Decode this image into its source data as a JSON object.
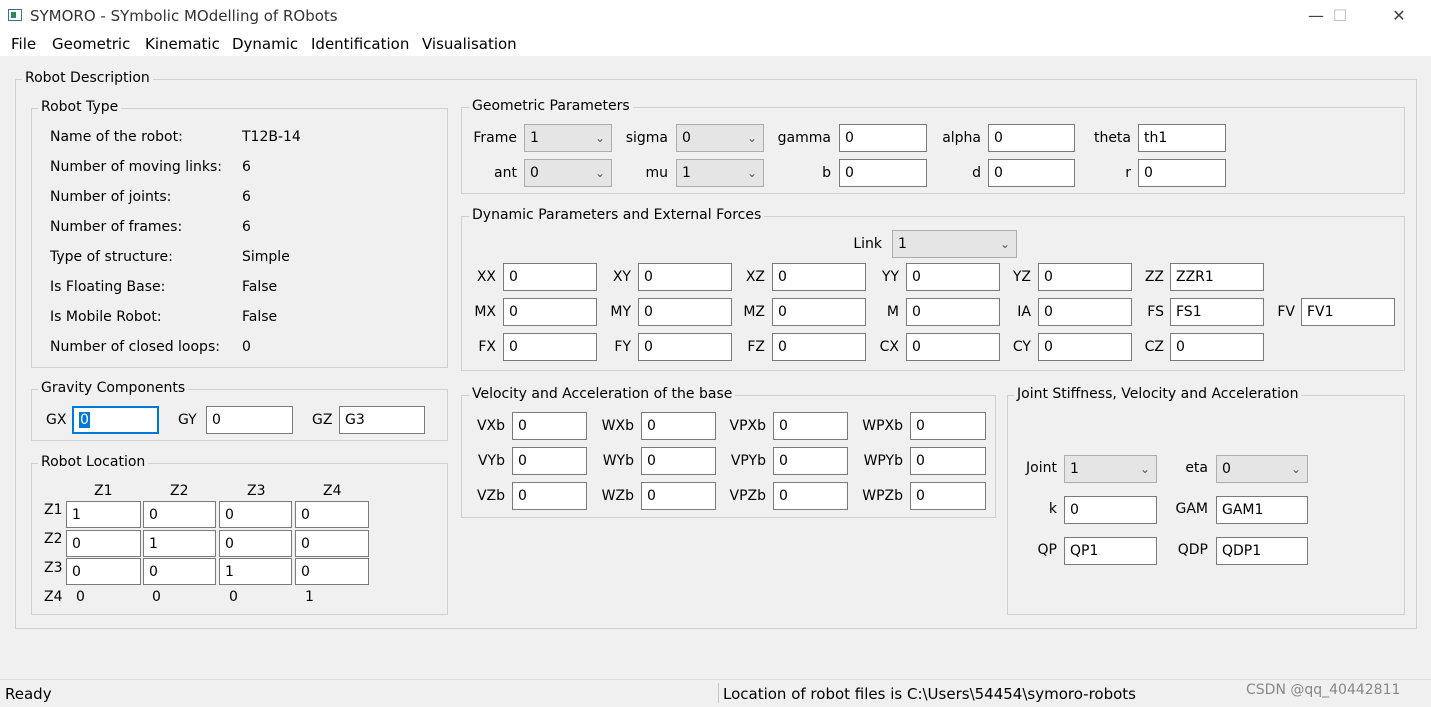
{
  "window": {
    "title": "SYMORO - SYmbolic MOdelling of RObots",
    "minimize": "—",
    "maximize": "☐",
    "close": "✕"
  },
  "menu": [
    "File",
    "Geometric",
    "Kinematic",
    "Dynamic",
    "Identification",
    "Visualisation"
  ],
  "robot_description": {
    "title": "Robot Description",
    "robot_type": {
      "title": "Robot Type",
      "rows": [
        {
          "label": "Name of the robot:",
          "value": "T12B-14"
        },
        {
          "label": "Number of moving links:",
          "value": "6"
        },
        {
          "label": "Number of joints:",
          "value": "6"
        },
        {
          "label": "Number of frames:",
          "value": "6"
        },
        {
          "label": "Type of structure:",
          "value": "Simple"
        },
        {
          "label": "Is Floating Base:",
          "value": "False"
        },
        {
          "label": "Is Mobile Robot:",
          "value": "False"
        },
        {
          "label": "Number of closed loops:",
          "value": "0"
        }
      ]
    },
    "gravity": {
      "title": "Gravity Components",
      "gx_label": "GX",
      "gx": "0",
      "gy_label": "GY",
      "gy": "0",
      "gz_label": "GZ",
      "gz": "G3"
    },
    "location": {
      "title": "Robot Location",
      "cols": [
        "Z1",
        "Z2",
        "Z3",
        "Z4"
      ],
      "rows": [
        {
          "label": "Z1",
          "values": [
            "1",
            "0",
            "0",
            "0"
          ]
        },
        {
          "label": "Z2",
          "values": [
            "0",
            "1",
            "0",
            "0"
          ]
        },
        {
          "label": "Z3",
          "values": [
            "0",
            "0",
            "1",
            "0"
          ]
        }
      ],
      "last_row": {
        "label": "Z4",
        "values": [
          "0",
          "0",
          "0",
          "1"
        ]
      }
    },
    "geometric": {
      "title": "Geometric Parameters",
      "frame_label": "Frame",
      "frame": "1",
      "sigma_label": "sigma",
      "sigma": "0",
      "gamma_label": "gamma",
      "gamma": "0",
      "alpha_label": "alpha",
      "alpha": "0",
      "theta_label": "theta",
      "theta": "th1",
      "ant_label": "ant",
      "ant": "0",
      "mu_label": "mu",
      "mu": "1",
      "b_label": "b",
      "b": "0",
      "d_label": "d",
      "d": "0",
      "r_label": "r",
      "r": "0"
    },
    "dynamic": {
      "title": "Dynamic Parameters and External Forces",
      "link_label": "Link",
      "link": "1",
      "row1": [
        {
          "label": "XX",
          "value": "0"
        },
        {
          "label": "XY",
          "value": "0"
        },
        {
          "label": "XZ",
          "value": "0"
        },
        {
          "label": "YY",
          "value": "0"
        },
        {
          "label": "YZ",
          "value": "0"
        },
        {
          "label": "ZZ",
          "value": "ZZR1"
        }
      ],
      "row2": [
        {
          "label": "MX",
          "value": "0"
        },
        {
          "label": "MY",
          "value": "0"
        },
        {
          "label": "MZ",
          "value": "0"
        },
        {
          "label": "M",
          "value": "0"
        },
        {
          "label": "IA",
          "value": "0"
        },
        {
          "label": "FS",
          "value": "FS1"
        },
        {
          "label": "FV",
          "value": "FV1"
        }
      ],
      "row3": [
        {
          "label": "FX",
          "value": "0"
        },
        {
          "label": "FY",
          "value": "0"
        },
        {
          "label": "FZ",
          "value": "0"
        },
        {
          "label": "CX",
          "value": "0"
        },
        {
          "label": "CY",
          "value": "0"
        },
        {
          "label": "CZ",
          "value": "0"
        }
      ]
    },
    "velocity": {
      "title": "Velocity and Acceleration of the base",
      "rows": [
        [
          {
            "label": "VXb",
            "value": "0"
          },
          {
            "label": "WXb",
            "value": "0"
          },
          {
            "label": "VPXb",
            "value": "0"
          },
          {
            "label": "WPXb",
            "value": "0"
          }
        ],
        [
          {
            "label": "VYb",
            "value": "0"
          },
          {
            "label": "WYb",
            "value": "0"
          },
          {
            "label": "VPYb",
            "value": "0"
          },
          {
            "label": "WPYb",
            "value": "0"
          }
        ],
        [
          {
            "label": "VZb",
            "value": "0"
          },
          {
            "label": "WZb",
            "value": "0"
          },
          {
            "label": "VPZb",
            "value": "0"
          },
          {
            "label": "WPZb",
            "value": "0"
          }
        ]
      ]
    },
    "joint": {
      "title": "Joint Stiffness, Velocity and Acceleration",
      "joint_label": "Joint",
      "joint": "1",
      "eta_label": "eta",
      "eta": "0",
      "k_label": "k",
      "k": "0",
      "gam_label": "GAM",
      "gam": "GAM1",
      "qp_label": "QP",
      "qp": "QP1",
      "qdp_label": "QDP",
      "qdp": "QDP1"
    }
  },
  "status": {
    "left": "Ready",
    "right": "Location of robot files is C:\\Users\\54454\\symoro-robots"
  },
  "watermark": "CSDN @qq_40442811"
}
